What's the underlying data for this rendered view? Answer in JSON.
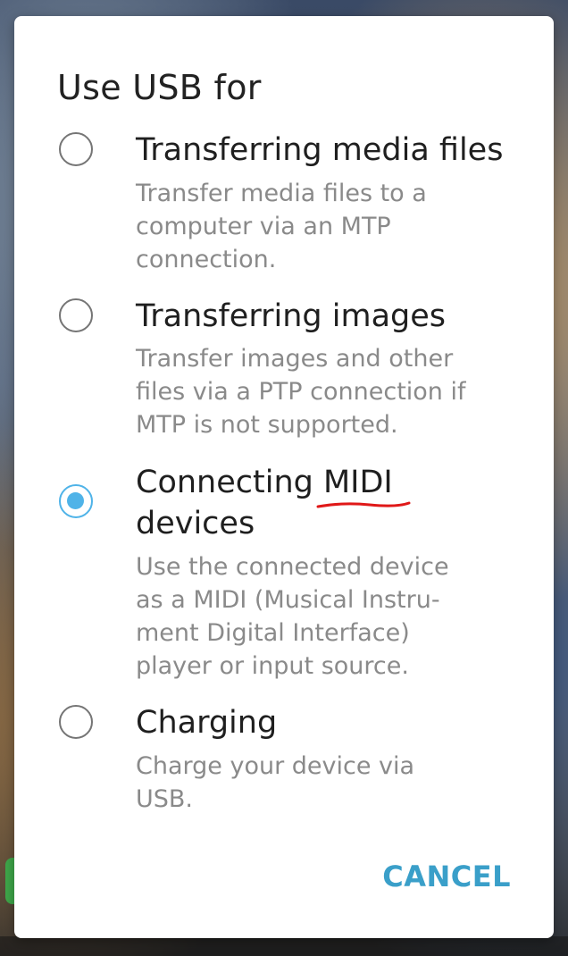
{
  "dialog": {
    "title": "Use USB for",
    "options": [
      {
        "title": "Transferring media files",
        "description": "Transfer media files to a computer via an MTP connection.",
        "selected": false
      },
      {
        "title": "Transferring images",
        "description": "Transfer images and other files via a PTP connection if MTP is not supported.",
        "selected": false
      },
      {
        "title": "Connecting MIDI devices",
        "description": "Use the connected device as a MIDI (Musical Instru- ment Digital Interface) player or input source.",
        "selected": true
      },
      {
        "title": "Charging",
        "description": "Charge your device via USB.",
        "selected": false
      }
    ],
    "cancel_label": "CANCEL"
  },
  "colors": {
    "accent": "#4fb3e8",
    "cancel_text": "#3a9fc9",
    "annotation_underline": "#e01818"
  },
  "icons": {
    "radio_unselected": "radio-unchecked-icon",
    "radio_selected": "radio-checked-icon"
  }
}
